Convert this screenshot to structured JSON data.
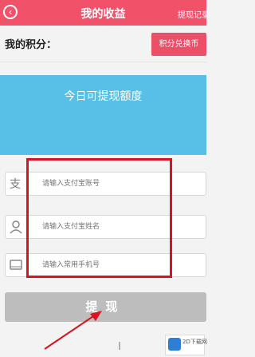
{
  "header": {
    "title": "我的收益",
    "back_glyph": "‹",
    "record_link": "提现记录"
  },
  "points": {
    "label": "我的积分：",
    "exchange_button": "积分兑换币"
  },
  "quota": {
    "title": "今日可提现额度"
  },
  "form": {
    "alipay_placeholder": "请输入支付宝账号",
    "name_placeholder": "请输入支付宝姓名",
    "phone_placeholder": "请输入常用手机号",
    "submit_label": "提现"
  },
  "watermark": {
    "text": "2D下载网"
  },
  "colors": {
    "header": "#f2516a",
    "quota_banner": "#58c0e6",
    "submit_disabled": "#bdbdbd",
    "annotation": "#d7141f"
  }
}
